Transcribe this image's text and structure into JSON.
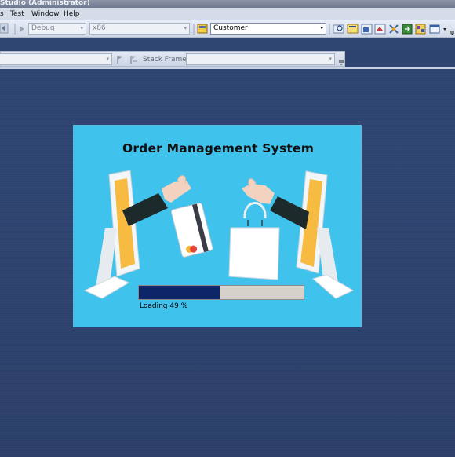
{
  "window": {
    "title": "Studio (Administrator)"
  },
  "menu": {
    "items": [
      "s",
      "Test",
      "Window",
      "Help"
    ]
  },
  "toolbar": {
    "config_value": "Debug",
    "platform_value": "x86",
    "project_value": "Customer",
    "stack_frame_label": "Stack Frame:"
  },
  "splash": {
    "title": "Order Management System",
    "loading_text": "Loading 49 %",
    "progress_fraction": 0.49,
    "background_color": "#3fc2ec",
    "progress_color": "#0c2668"
  },
  "icons": {
    "debug_start": "play-icon",
    "find": "find-icon",
    "properties": "properties-icon",
    "toolbox": "toolbox-icon"
  }
}
